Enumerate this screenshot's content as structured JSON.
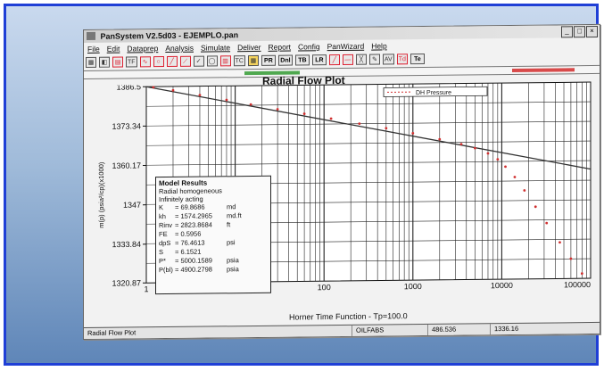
{
  "window": {
    "title": "PanSystem V2.5d03 - EJEMPLO.pan",
    "controls": [
      "_",
      "□",
      "×"
    ]
  },
  "menu": [
    "File",
    "Edit",
    "Dataprep",
    "Analysis",
    "Simulate",
    "Deliver",
    "Report",
    "Config",
    "PanWizard",
    "Help"
  ],
  "toolbar": [
    "TF",
    "TC",
    "PR",
    "Dnl",
    "TB",
    "LR",
    "AV",
    "Td",
    "Te"
  ],
  "plot": {
    "title": "Radial Flow Plot",
    "xlabel": "Horner Time Function - Tp=100.0",
    "ylabel": "m(p) (psia²/cp)(x1000)",
    "legend": "DH Pressure"
  },
  "model": {
    "title": "Model Results",
    "lines": [
      "Radial homogeneous",
      "Infinitely acting"
    ],
    "params": [
      {
        "k": "K",
        "v": "= 69.8686",
        "u": "md"
      },
      {
        "k": "kh",
        "v": "= 1574.2965",
        "u": "md.ft"
      },
      {
        "k": "Rinv",
        "v": "= 2823.8684",
        "u": "ft"
      },
      {
        "k": "FE",
        "v": "= 0.5956",
        "u": ""
      },
      {
        "k": "dpS",
        "v": "= 76.4613",
        "u": "psi"
      },
      {
        "k": "S",
        "v": "= 6.1521",
        "u": ""
      },
      {
        "k": "P*",
        "v": "= 5000.1589",
        "u": "psia"
      },
      {
        "k": "P(bl)",
        "v": "= 4900.2798",
        "u": "psia"
      }
    ]
  },
  "status": {
    "left": "Radial Flow Plot",
    "mode": "OILFABS",
    "x": "486.536",
    "y": "1336.16"
  },
  "chart_data": {
    "type": "scatter",
    "title": "Radial Flow Plot",
    "xlabel": "Horner Time Function - Tp=100.0",
    "ylabel": "m(p) (psia²/cp)(x1000)",
    "xscale": "log",
    "xlim": [
      1,
      100000
    ],
    "ylim": [
      1320.87,
      1386.5
    ],
    "xticks": [
      "1",
      "10",
      "100",
      "1000",
      "10000",
      "100000"
    ],
    "yticks": [
      "1386.5",
      "1373.34",
      "1360.17",
      "1347",
      "1333.84",
      "1320.87"
    ],
    "legend": "DH Pressure",
    "series": [
      {
        "name": "DH Pressure",
        "x": [
          1.2,
          2,
          4,
          8,
          15,
          30,
          60,
          120,
          250,
          500,
          1000,
          2000,
          3500,
          5000,
          7000,
          9000,
          11000,
          14000,
          18000,
          24000,
          32000,
          45000,
          60000,
          80000
        ],
        "y": [
          1386.3,
          1385.2,
          1383.5,
          1381.8,
          1380.2,
          1378.5,
          1376.9,
          1375.2,
          1373.4,
          1371.8,
          1370.0,
          1367.9,
          1366.2,
          1364.8,
          1363.0,
          1361.0,
          1358.5,
          1355.0,
          1350.5,
          1345.0,
          1339.5,
          1333.0,
          1327.5,
          1322.5
        ]
      }
    ],
    "fit_line": {
      "x": [
        1,
        100000
      ],
      "y": [
        1386.5,
        1357.4
      ]
    }
  }
}
